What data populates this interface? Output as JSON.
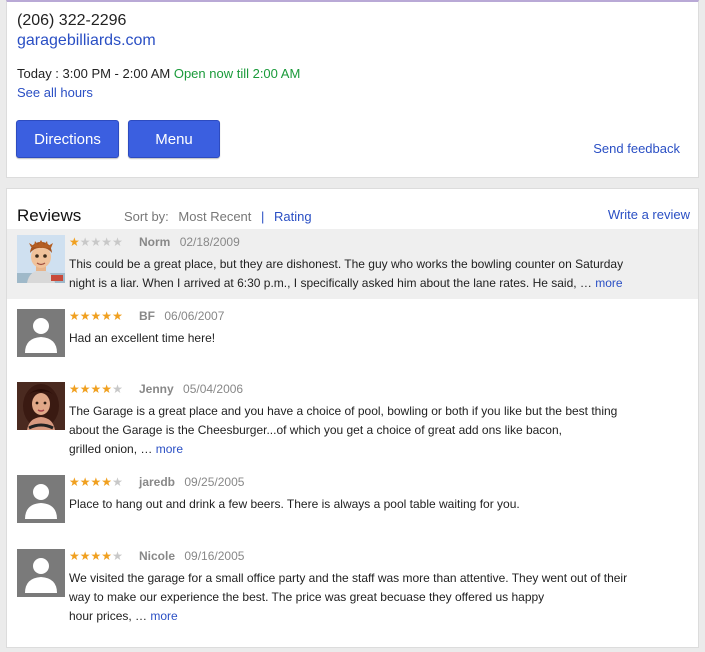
{
  "business": {
    "phone": "(206) 322-2296",
    "website": "garagebilliards.com",
    "hours_label": "Today : 3:00 PM - 2:00 AM",
    "open_status": "Open now till 2:00 AM",
    "see_all_hours": "See all hours"
  },
  "actions": {
    "directions": "Directions",
    "menu": "Menu",
    "send_feedback": "Send feedback"
  },
  "reviews": {
    "title": "Reviews",
    "sort_label": "Sort by:",
    "sort_current": "Most Recent",
    "sort_separator": "|",
    "sort_alt": "Rating",
    "write_review": "Write a review",
    "items": [
      {
        "author": "Norm",
        "date": "02/18/2009",
        "rating": 1,
        "text_lines": [
          "This could be a great place, but they are dishonest. The guy who works the bowling counter on Saturday",
          "night is a liar. When I arrived at 6:30 p.m., I specifically asked him about the lane rates. He said, …"
        ],
        "more": "more"
      },
      {
        "author": "BF",
        "date": "06/06/2007",
        "rating": 5,
        "text_lines": [
          "Had an excellent time here!"
        ],
        "more": ""
      },
      {
        "author": "Jenny",
        "date": "05/04/2006",
        "rating": 4,
        "text_lines": [
          "The Garage is a great place and you have a choice of pool, bowling or both if you like but the best thing",
          "about the Garage is the Cheesburger...of which you get a choice of great add ons like bacon,",
          "grilled onion, …"
        ],
        "more": "more"
      },
      {
        "author": "jaredb",
        "date": "09/25/2005",
        "rating": 4,
        "text_lines": [
          "Place to hang out and drink a few beers. There is always a pool table waiting for you."
        ],
        "more": ""
      },
      {
        "author": "Nicole",
        "date": "09/16/2005",
        "rating": 4,
        "text_lines": [
          "We visited the garage for a small office party and the staff was more than attentive. They went out of their",
          "way to make our experience the best. The price was great becuase they offered us happy",
          "hour prices, …"
        ],
        "more": "more"
      }
    ]
  },
  "colors": {
    "link": "#2a4fc4",
    "button": "#3b5fe0",
    "open": "#1a9a3a",
    "star_on": "#f0a020",
    "star_off": "#c8c8c8"
  }
}
